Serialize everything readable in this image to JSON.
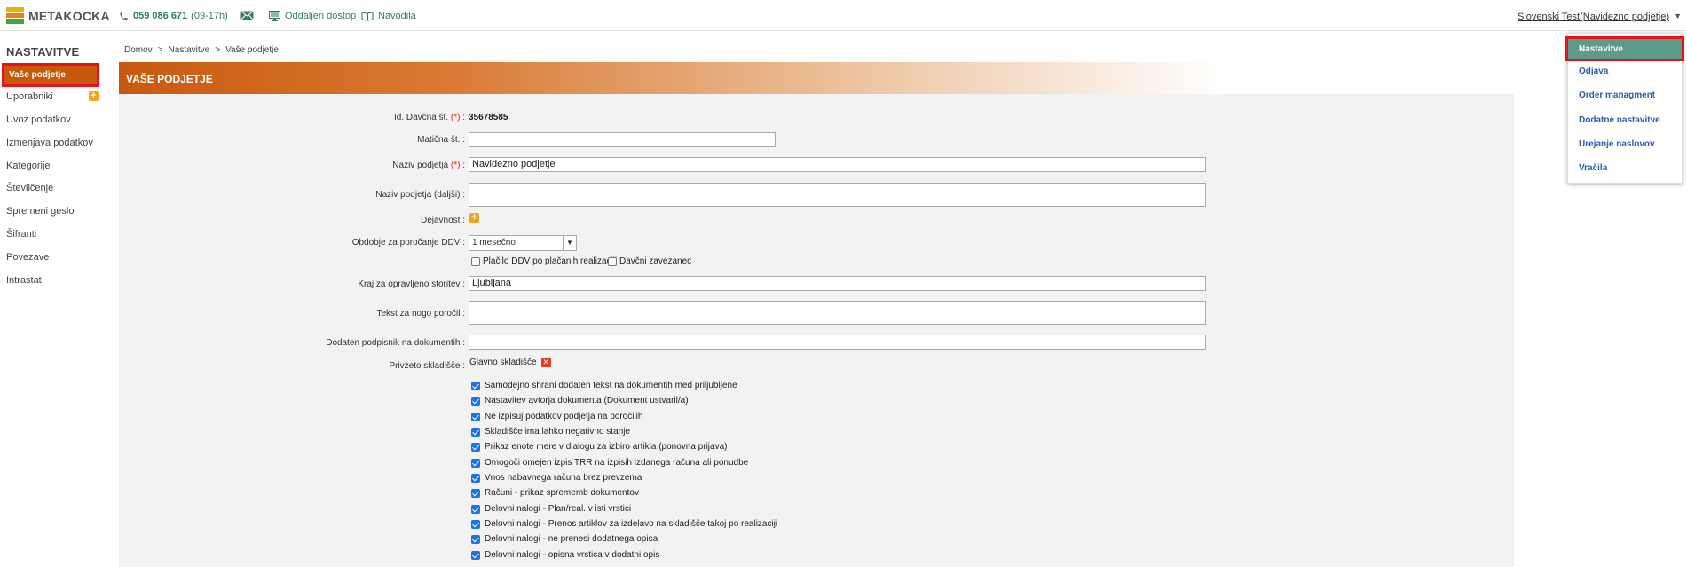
{
  "topbar": {
    "logo_text": "METAKOCKA",
    "phone_number": "059 086 671",
    "phone_hours": "(09-17h)",
    "remote_label": "Oddaljen dostop",
    "docs_label": "Navodila",
    "user_label": "Slovenski Test(Navidezno podjetje)"
  },
  "sidebar": {
    "title": "NASTAVITVE",
    "active_label": "Vaše podjetje",
    "items": [
      {
        "label": "Uporabniki"
      },
      {
        "label": "Uvoz podatkov"
      },
      {
        "label": "Izmenjava podatkov"
      },
      {
        "label": "Kategorije"
      },
      {
        "label": "Številčenje"
      },
      {
        "label": "Spremeni geslo"
      },
      {
        "label": "Šifranti"
      },
      {
        "label": "Povezave"
      },
      {
        "label": "Intrastat"
      }
    ]
  },
  "breadcrumb": {
    "items": [
      "Domov",
      "Nastavitve",
      "Vaše podjetje"
    ],
    "separator": ">"
  },
  "header": {
    "title": "VAŠE PODJETJE"
  },
  "form": {
    "tax_id_label": "Id. Davčna št.",
    "req_mark": "(*)",
    "tax_id_value": "35678585",
    "reg_no_label": "Matična št. :",
    "reg_no_value": "",
    "company_name_label": "Naziv podjetja",
    "company_name_value": "Navidezno podjetje",
    "company_name_ext_label": "Naziv podjetja (daljši) :",
    "company_name_ext_value": "",
    "activity_label": "Dejavnost :",
    "vat_period_label": "Obdobje za poročanje DDV :",
    "vat_period_value": "1 mesečno",
    "vat_paid_label": "Plačilo DDV po plačanih realizaciji",
    "taxpayer_label": "Davčni zavezanec",
    "service_place_label": "Kraj za opravljeno storitev :",
    "service_place_value": "Ljubljana",
    "footer_text_label": "Tekst za nogo poročil :",
    "footer_text_value": "",
    "extra_signer_label": "Dodaten podpisnik na dokumentih :",
    "extra_signer_value": "",
    "warehouse_label": "Privzeto skladišče :",
    "warehouse_value": "Glavno skladišče",
    "options": [
      {
        "label": "Samodejno shrani dodaten tekst na dokumentih med priljubljene",
        "checked": true
      },
      {
        "label": "Nastavitev avtorja dokumenta (Dokument ustvaril/a)",
        "checked": true
      },
      {
        "label": "Ne izpisuj podatkov podjetja na poročilih",
        "checked": true
      },
      {
        "label": "Skladišče ima lahko negativno stanje",
        "checked": true
      },
      {
        "label": "Prikaz enote mere v dialogu za izbiro artikla (ponovna prijava)",
        "checked": true
      },
      {
        "label": "Omogoči omejen izpis TRR na izpisih izdanega računa ali ponudbe",
        "checked": true
      },
      {
        "label": "Vnos nabavnega računa brez prevzema",
        "checked": true
      },
      {
        "label": "Računi - prikaz sprememb dokumentov",
        "checked": true
      },
      {
        "label": "Delovni nalogi - Plan/real. v isti vrstici",
        "checked": true
      },
      {
        "label": "Delovni nalogi - Prenos artiklov za izdelavo na skladišče takoj po realizaciji",
        "checked": true
      },
      {
        "label": "Delovni nalogi - ne prenesi dodatnega opisa",
        "checked": true
      },
      {
        "label": "Delovni nalogi - opisna vrstica v dodatni opis",
        "checked": true
      }
    ]
  },
  "user_menu": {
    "items": [
      {
        "label": "Nastavitve"
      },
      {
        "label": "Odjava"
      },
      {
        "label": "Order managment"
      },
      {
        "label": "Dodatne nastavitve"
      },
      {
        "label": "Urejanje naslovov"
      },
      {
        "label": "Vračila"
      }
    ]
  },
  "colors": {
    "accent_orange": "#c6580c",
    "highlight_red": "#e8101b",
    "menu_active": "#5c9a8c",
    "link_blue": "#2c5caa"
  }
}
